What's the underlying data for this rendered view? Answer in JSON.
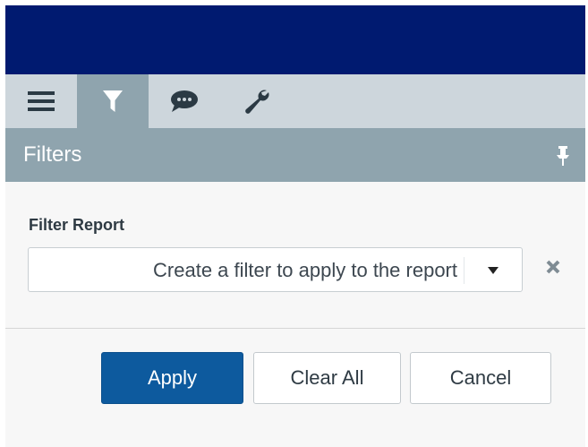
{
  "colors": {
    "topbar": "#001a70",
    "tabstrip": "#cdd6dc",
    "active_tab": "#8fa4ae",
    "panel_header": "#8fa4ae",
    "apply_button": "#0d5a9e"
  },
  "tabs": [
    {
      "name": "menu",
      "icon": "hamburger-menu-icon"
    },
    {
      "name": "filters",
      "icon": "funnel-filter-icon",
      "active": true
    },
    {
      "name": "comments",
      "icon": "speech-bubble-icon"
    },
    {
      "name": "tools",
      "icon": "wrench-icon"
    }
  ],
  "panel": {
    "title": "Filters",
    "pin_icon": "pin-icon"
  },
  "filter": {
    "label": "Filter Report",
    "placeholder": "Create a filter to apply to the report",
    "clear_icon": "close-x-icon"
  },
  "buttons": {
    "apply": "Apply",
    "clear_all": "Clear All",
    "cancel": "Cancel"
  }
}
